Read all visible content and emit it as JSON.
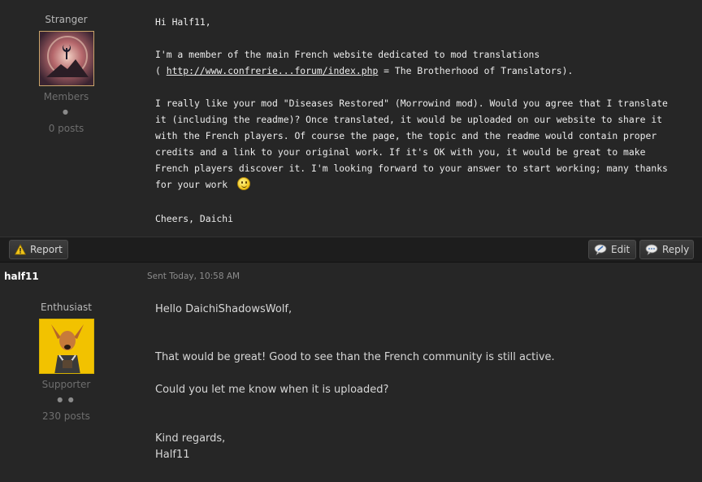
{
  "post1": {
    "author_rank": "Stranger",
    "group": "Members",
    "pips": "●",
    "posts": "0 posts",
    "lines": [
      "Hi Half11,",
      "",
      "I'm a member of the main French website dedicated to mod translations",
      "",
      "",
      "I really like your mod \"Diseases Restored\" (Morrowind mod). Would you agree that I translate",
      "it (including the readme)? Once translated, it would be uploaded on our website to share it",
      "with the French players. Of course the page, the topic and the readme would contain proper",
      "credits and a link to your original work. If it's OK with you, it would be great to make",
      "French players discover it. I'm looking forward to your answer to start working; many thanks",
      "for your work",
      "",
      "Cheers, Daichi"
    ],
    "link_prefix": "( ",
    "link_text": "http://www.confrerie...forum/index.php",
    "link_suffix": " = The Brotherhood of Translators)."
  },
  "toolbar": {
    "report_label": "Report",
    "edit_label": "Edit",
    "reply_label": "Reply"
  },
  "post2": {
    "author": "half11",
    "sent": "Sent Today, 10:58 AM",
    "author_rank": "Enthusiast",
    "group": "Supporter",
    "pips": "● ●",
    "posts": "230 posts",
    "greeting": "Hello DaichiShadowsWolf,",
    "para1": "That would be great! Good to see than the French community is still active.",
    "para2": "Could you let me know when it is uploaded?",
    "closing1": "Kind regards,",
    "closing2": "Half11"
  },
  "icons": {
    "report": "warning-icon",
    "edit": "edit-bubble-icon",
    "reply": "reply-bubble-icon",
    "smiley": "smiley-icon"
  }
}
